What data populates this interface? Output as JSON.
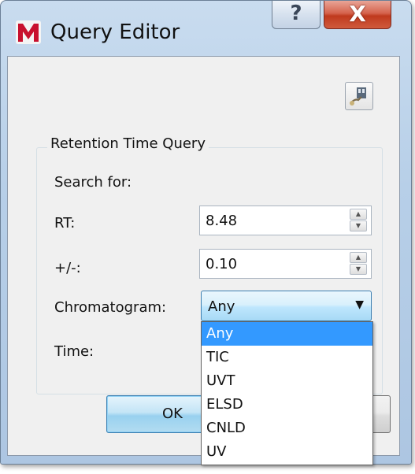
{
  "window": {
    "title": "Query Editor",
    "help_label": "?",
    "close_label": "X"
  },
  "group": {
    "legend": "Retention Time Query",
    "search_for_label": "Search for:"
  },
  "fields": {
    "rt_label": "RT:",
    "rt_value": "8.48",
    "tolerance_label": "+/-:",
    "tolerance_value": "0.10",
    "chromatogram_label": "Chromatogram:",
    "chromatogram_value": "Any",
    "time_label": "Time:"
  },
  "dropdown": {
    "options": [
      "Any",
      "TIC",
      "UVT",
      "ELSD",
      "CNLD",
      "UV"
    ],
    "selected_index": 0
  },
  "buttons": {
    "ok_label": "OK"
  },
  "icons": {
    "app": "app-logo-icon",
    "tool": "query-tool-icon",
    "spin_up": "arrow-up-icon",
    "spin_down": "arrow-down-icon",
    "dropdown_arrow": "chevron-down-icon"
  },
  "colors": {
    "selection": "#3399ff",
    "close_button": "#c8452a",
    "titlebar": "#b7cfe8"
  }
}
